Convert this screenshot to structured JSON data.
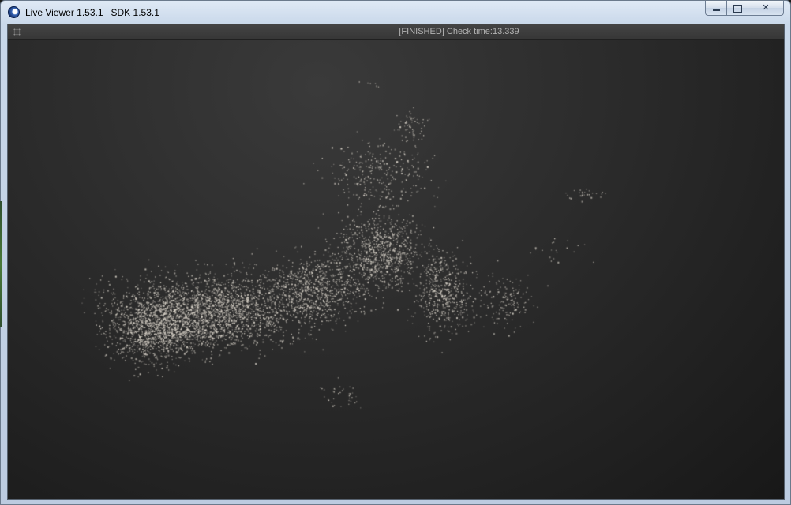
{
  "window": {
    "title": "Live Viewer 1.53.1   SDK 1.53.1",
    "app_icon": "cinema4d-icon",
    "buttons": {
      "minimize": "minimize-icon",
      "maximize": "maximize-icon",
      "close": "close-icon"
    }
  },
  "statusbar": {
    "grip_icon": "grip-icon",
    "text": "[FINISHED] Check time:13.339"
  },
  "viewport": {
    "content": "particle-cloud-render",
    "background_color": "#2b2b2b",
    "particle_color": "#d8d2c8"
  }
}
